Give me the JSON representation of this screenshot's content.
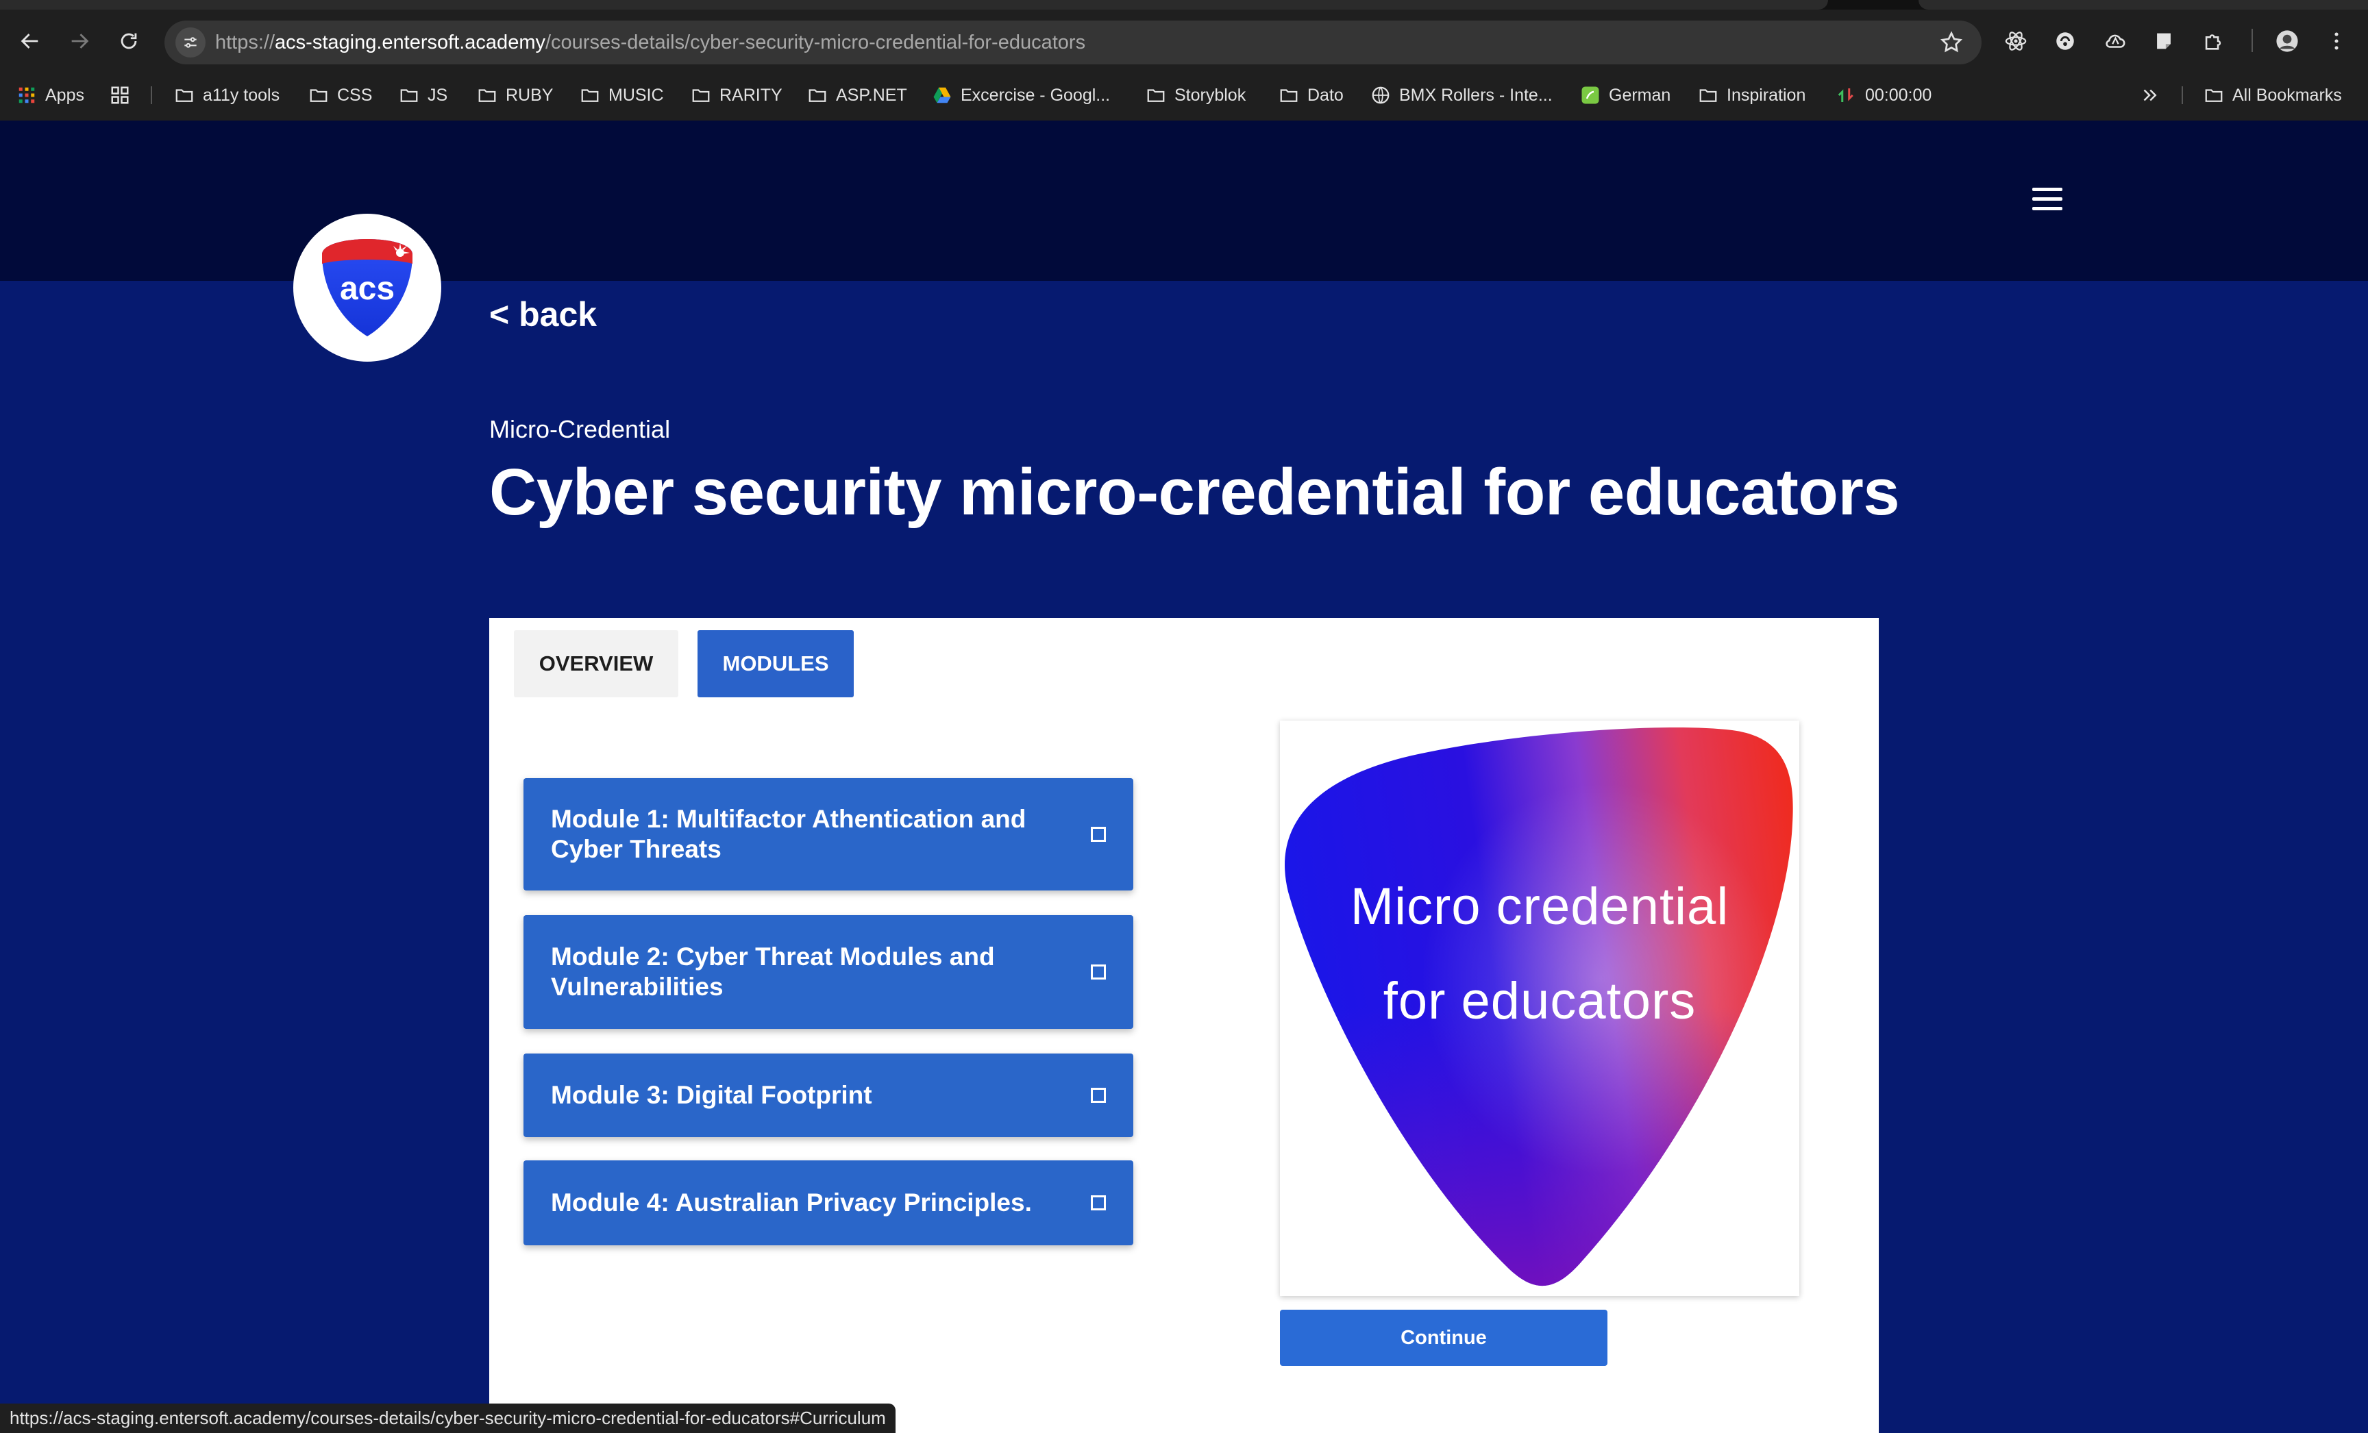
{
  "browser": {
    "url": "https://acs-staging.entersoft.academy/courses-details/cyber-security-micro-credential-for-educators",
    "url_host": "acs-staging.entersoft.academy",
    "url_path": "/courses-details/cyber-security-micro-credential-for-educators",
    "status_url": "https://acs-staging.entersoft.academy/courses-details/cyber-security-micro-credential-for-educators#Curriculum",
    "bookmarks": [
      {
        "label": "Apps",
        "icon": "apps-grid-icon"
      },
      {
        "label": "",
        "icon": "tab-groups-icon"
      },
      {
        "label": "a11y tools",
        "icon": "folder-icon"
      },
      {
        "label": "CSS",
        "icon": "folder-icon"
      },
      {
        "label": "JS",
        "icon": "folder-icon"
      },
      {
        "label": "RUBY",
        "icon": "folder-icon"
      },
      {
        "label": "MUSIC",
        "icon": "folder-icon"
      },
      {
        "label": "RARITY",
        "icon": "folder-icon"
      },
      {
        "label": "ASP.NET",
        "icon": "folder-icon"
      },
      {
        "label": "Excercise - Googl...",
        "icon": "google-drive-icon"
      },
      {
        "label": "Storyblok",
        "icon": "folder-icon"
      },
      {
        "label": "Dato",
        "icon": "folder-icon"
      },
      {
        "label": "BMX Rollers - Inte...",
        "icon": "globe-icon"
      },
      {
        "label": "German",
        "icon": "german-app-icon"
      },
      {
        "label": "Inspiration",
        "icon": "folder-icon"
      },
      {
        "label": "00:00:00",
        "icon": "timer-icon"
      }
    ],
    "all_bookmarks_label": "All Bookmarks"
  },
  "page": {
    "back_label": "< back",
    "category": "Micro-Credential",
    "title": "Cyber security micro-credential for educators",
    "logo_text": "acs",
    "tabs": [
      {
        "label": "OVERVIEW",
        "active": false
      },
      {
        "label": "MODULES",
        "active": true
      }
    ],
    "modules": [
      {
        "label": "Module 1: Multifactor Athentication and Cyber Threats",
        "checked": false
      },
      {
        "label": "Module 2: Cyber Threat Modules and Vulnerabilities",
        "checked": false
      },
      {
        "label": "Module 3: Digital Footprint",
        "checked": false
      },
      {
        "label": "Module 4: Australian Privacy Principles.",
        "checked": false
      }
    ],
    "image_text_line1": "Micro credential",
    "image_text_line2": "for educators",
    "continue_label": "Continue"
  },
  "colors": {
    "header": "#010a3a",
    "page_bg": "#061a70",
    "accent": "#2a66c9",
    "chrome": "#1f1f1f"
  }
}
